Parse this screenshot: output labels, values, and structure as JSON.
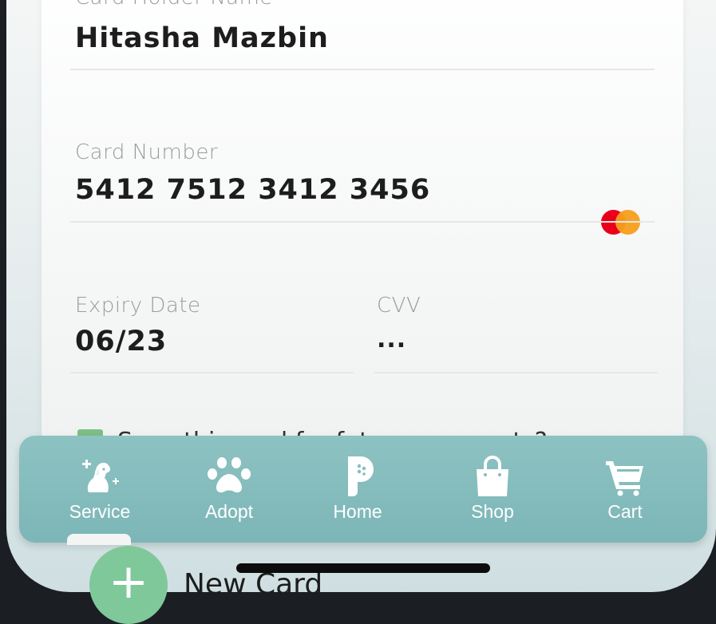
{
  "form": {
    "holder": {
      "label": "Card Holder Name",
      "value": "Hitasha Mazbin"
    },
    "number": {
      "label": "Card Number",
      "value": "5412 7512 3412 3456",
      "brand_icon": "mastercard-icon"
    },
    "expiry": {
      "label": "Expiry Date",
      "value": "06/23"
    },
    "cvv": {
      "label": "CVV",
      "value": "..."
    },
    "save_card": {
      "label": "Save this card for future payments?"
    }
  },
  "nav": {
    "items": [
      {
        "label": "Service",
        "icon": "dog-icon"
      },
      {
        "label": "Adopt",
        "icon": "paw-icon"
      },
      {
        "label": "Home",
        "icon": "p-logo-icon"
      },
      {
        "label": "Shop",
        "icon": "shopping-bag-icon"
      },
      {
        "label": "Cart",
        "icon": "cart-icon"
      }
    ],
    "active_index": 0
  },
  "new_card": {
    "symbol": "+",
    "label": "New Card"
  },
  "colors": {
    "navbar": "#85bcbd",
    "accent_green": "#7fc89a",
    "mastercard_red": "#eb001b",
    "mastercard_orange": "#f79e1b"
  }
}
